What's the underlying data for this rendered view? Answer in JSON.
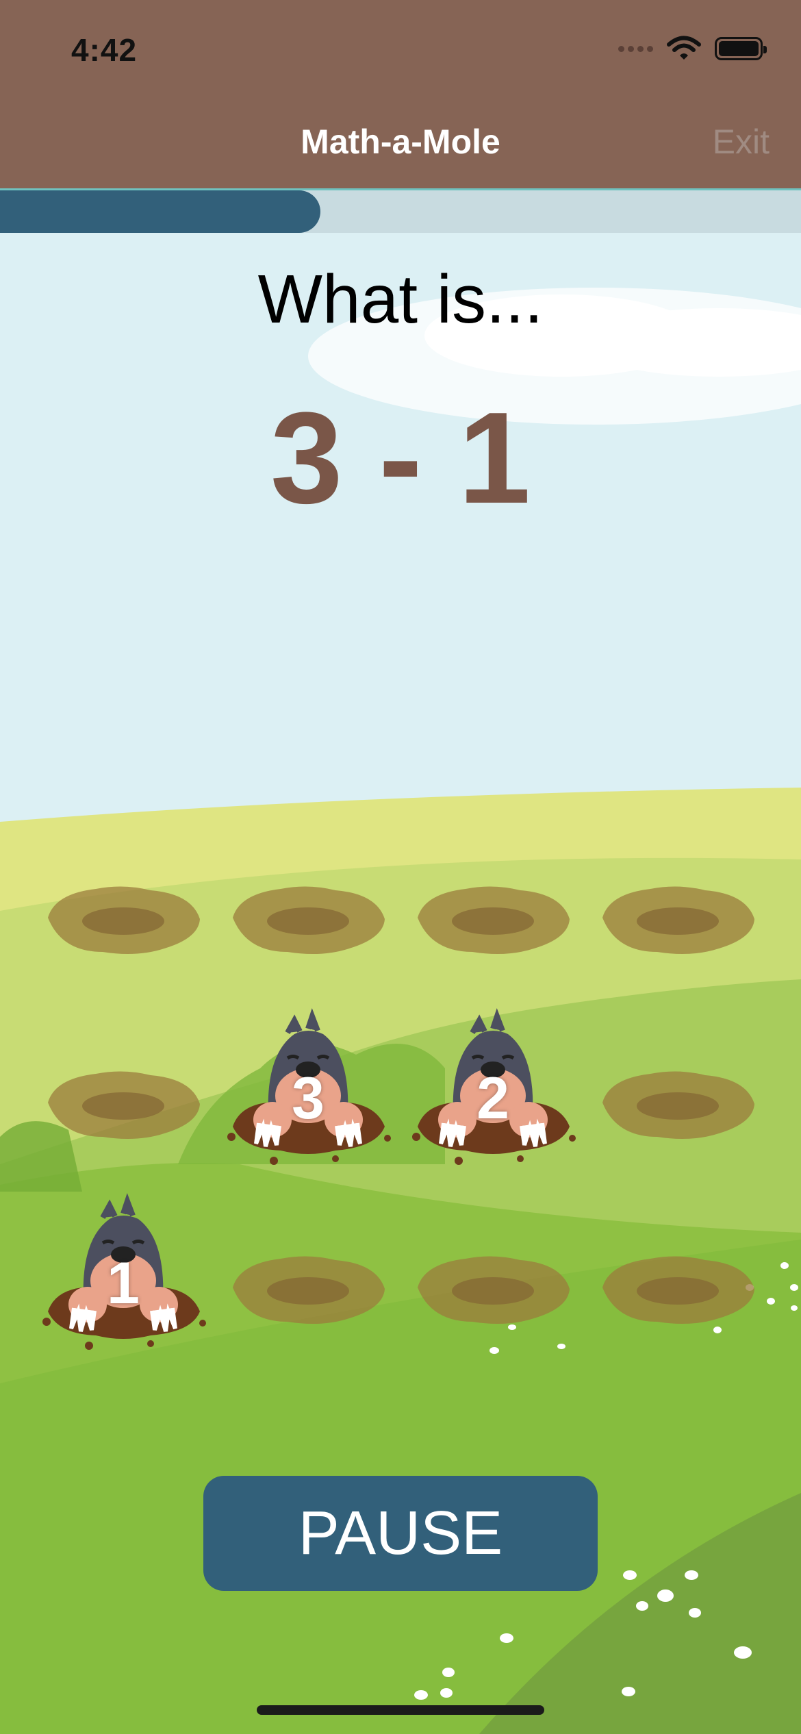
{
  "status_bar": {
    "time": "4:42",
    "icons": [
      "signal-icon",
      "wifi-icon",
      "battery-icon"
    ]
  },
  "nav": {
    "title": "Math-a-Mole",
    "exit_label": "Exit"
  },
  "progress": {
    "value": 0.4
  },
  "question": {
    "prompt": "What is...",
    "problem": "3 - 1"
  },
  "moles": [
    {
      "row": 1,
      "col": 1,
      "label": "3"
    },
    {
      "row": 1,
      "col": 2,
      "label": "2"
    },
    {
      "row": 2,
      "col": 0,
      "label": "1"
    }
  ],
  "controls": {
    "pause_label": "PAUSE"
  },
  "colors": {
    "header": "#866455",
    "accent": "#32607a",
    "problem_text": "#7a5648"
  }
}
